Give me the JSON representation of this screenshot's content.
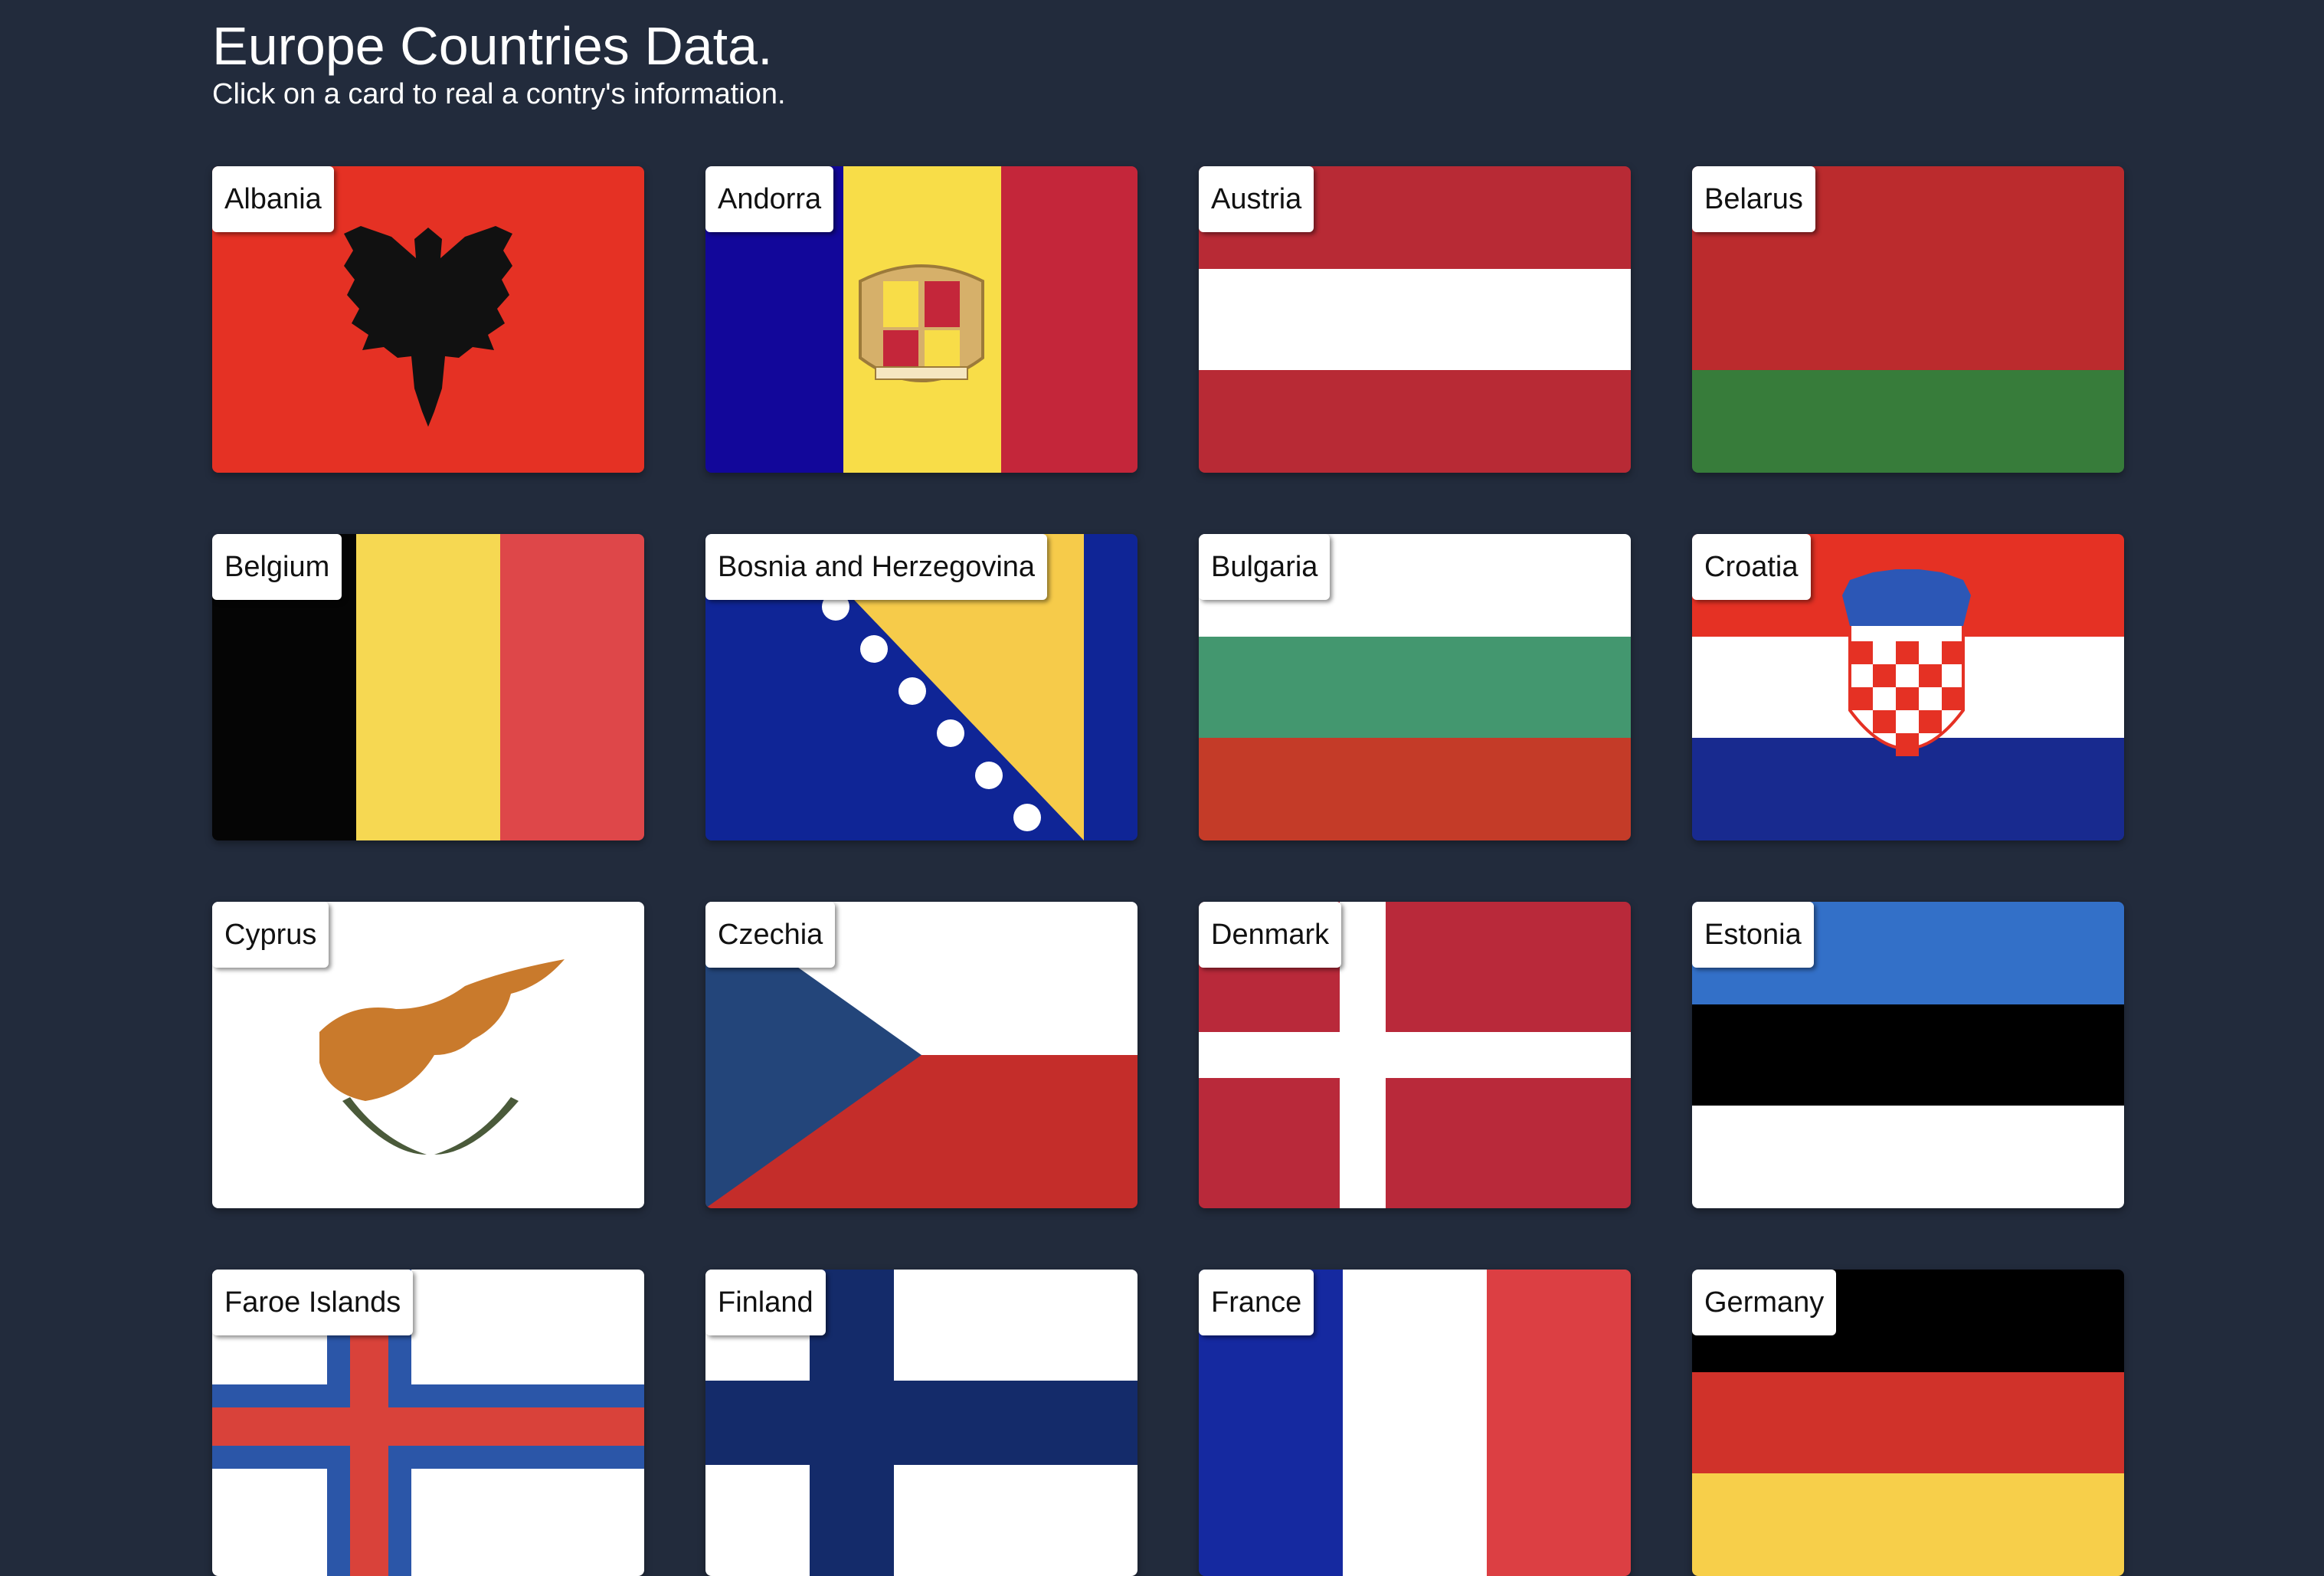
{
  "header": {
    "title": "Europe Countries Data.",
    "subtitle": "Click on a card to real a contry's information."
  },
  "countries": [
    {
      "name": "Albania"
    },
    {
      "name": "Andorra"
    },
    {
      "name": "Austria"
    },
    {
      "name": "Belarus"
    },
    {
      "name": "Belgium"
    },
    {
      "name": "Bosnia and Herzegovina"
    },
    {
      "name": "Bulgaria"
    },
    {
      "name": "Croatia"
    },
    {
      "name": "Cyprus"
    },
    {
      "name": "Czechia"
    },
    {
      "name": "Denmark"
    },
    {
      "name": "Estonia"
    },
    {
      "name": "Faroe Islands"
    },
    {
      "name": "Finland"
    },
    {
      "name": "France"
    },
    {
      "name": "Germany"
    }
  ],
  "colors": {
    "background": "#222b3c",
    "label_bg": "#ffffff"
  }
}
